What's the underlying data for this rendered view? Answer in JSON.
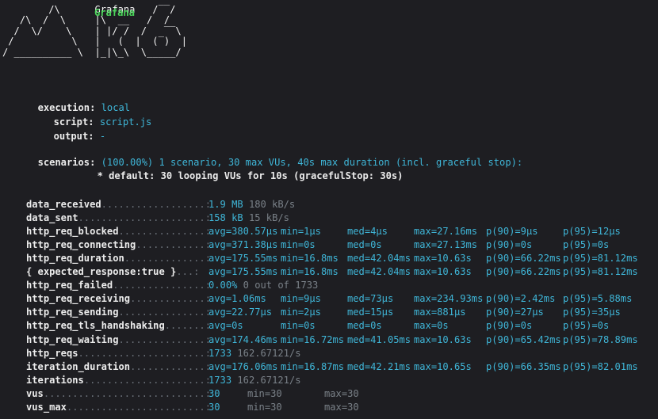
{
  "logo": {
    "art": "        /\\      Grafana   /‾‾/\n   /\\  /  \\     |\\  __   /  /\n  /  \\/    \\    | |/ /  /   ‾‾\\\n /          \\   |   (  |  (‾)  |\n/ __________ \\  |_|\\_\\  \\_____/",
    "brand": "Grafana"
  },
  "options": [
    {
      "key": "execution:",
      "value": "local"
    },
    {
      "key": "script:",
      "value": "script.js"
    },
    {
      "key": "output:",
      "value": "-"
    }
  ],
  "scenarios": {
    "key": "scenarios:",
    "value": "(100.00%) 1 scenario, 30 max VUs, 40s max duration (incl. graceful stop):",
    "detail": "* default: 30 looping VUs for 10s (gracefulStop: 30s)"
  },
  "metrics": [
    {
      "name": "data_received",
      "dots": "..................:",
      "type": "rate",
      "value": "1.9 MB",
      "rate": "180 kB/s"
    },
    {
      "name": "data_sent",
      "dots": "......................:",
      "type": "rate",
      "value": "158 kB",
      "rate": "15 kB/s"
    },
    {
      "name": "http_req_blocked",
      "dots": "...............:",
      "type": "trend",
      "avg": "avg=380.57µs",
      "min": "min=1µs",
      "med": "med=4µs",
      "max": "max=27.16ms",
      "p90": "p(90)=9µs",
      "p95": "p(95)=12µs"
    },
    {
      "name": "http_req_connecting",
      "dots": "............:",
      "type": "trend",
      "avg": "avg=371.38µs",
      "min": "min=0s",
      "med": "med=0s",
      "max": "max=27.13ms",
      "p90": "p(90)=0s",
      "p95": "p(95)=0s"
    },
    {
      "name": "http_req_duration",
      "dots": "..............:",
      "type": "trend",
      "avg": "avg=175.55ms",
      "min": "min=16.8ms",
      "med": "med=42.04ms",
      "max": "max=10.63s",
      "p90": "p(90)=66.22ms",
      "p95": "p(95)=81.12ms"
    },
    {
      "name": "  { expected_response:true }",
      "dots": "...:",
      "type": "trend",
      "avg": "avg=175.55ms",
      "min": "min=16.8ms",
      "med": "med=42.04ms",
      "max": "max=10.63s",
      "p90": "p(90)=66.22ms",
      "p95": "p(95)=81.12ms"
    },
    {
      "name": "http_req_failed",
      "dots": "................:",
      "type": "count",
      "value": "0.00%",
      "rate": "0 out of 1733"
    },
    {
      "name": "http_req_receiving",
      "dots": ".............:",
      "type": "trend",
      "avg": "avg=1.06ms",
      "min": "min=9µs",
      "med": "med=73µs",
      "max": "max=234.93ms",
      "p90": "p(90)=2.42ms",
      "p95": "p(95)=5.88ms"
    },
    {
      "name": "http_req_sending",
      "dots": "...............:",
      "type": "trend",
      "avg": "avg=22.77µs",
      "min": "min=2µs",
      "med": "med=15µs",
      "max": "max=881µs",
      "p90": "p(90)=27µs",
      "p95": "p(95)=35µs"
    },
    {
      "name": "http_req_tls_handshaking",
      "dots": ".......:",
      "type": "trend",
      "avg": "avg=0s",
      "min": "min=0s",
      "med": "med=0s",
      "max": "max=0s",
      "p90": "p(90)=0s",
      "p95": "p(95)=0s"
    },
    {
      "name": "http_req_waiting",
      "dots": "...............:",
      "type": "trend",
      "avg": "avg=174.46ms",
      "min": "min=16.72ms",
      "med": "med=41.05ms",
      "max": "max=10.63s",
      "p90": "p(90)=65.42ms",
      "p95": "p(95)=78.89ms"
    },
    {
      "name": "http_reqs",
      "dots": "......................:",
      "type": "rate",
      "value": "1733",
      "rate": "162.67121/s"
    },
    {
      "name": "iteration_duration",
      "dots": ".............:",
      "type": "trend",
      "avg": "avg=176.06ms",
      "min": "min=16.87ms",
      "med": "med=42.21ms",
      "max": "max=10.65s",
      "p90": "p(90)=66.35ms",
      "p95": "p(95)=82.01ms"
    },
    {
      "name": "iterations",
      "dots": ".....................:",
      "type": "rate",
      "value": "1733",
      "rate": "162.67121/s"
    },
    {
      "name": "vus",
      "dots": "............................:",
      "type": "gauge",
      "value": "30",
      "min": "min=30",
      "max": "max=30"
    },
    {
      "name": "vus_max",
      "dots": "........................:",
      "type": "gauge",
      "value": "30",
      "min": "min=30",
      "max": "max=30"
    }
  ],
  "colors": {
    "background": "#1e1e22",
    "cyan": "#3fb6d8",
    "green": "#4ad55a",
    "dim": "#7a8188"
  }
}
